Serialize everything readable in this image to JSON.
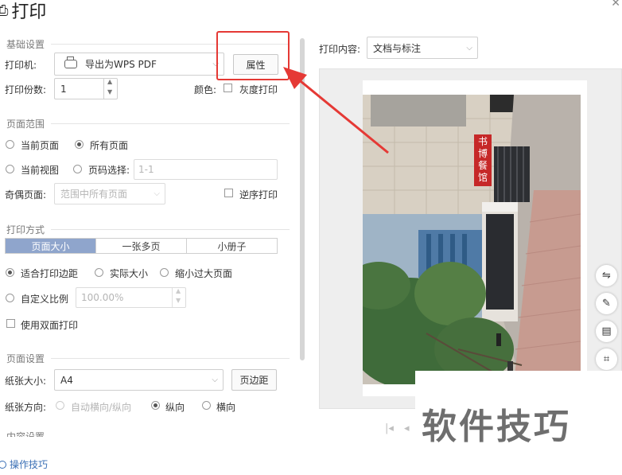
{
  "window": {
    "title": "打印"
  },
  "basic": {
    "section_title": "基础设置",
    "printer_label": "打印机:",
    "printer_value": "导出为WPS PDF",
    "properties_button": "属性",
    "copies_label": "打印份数:",
    "copies_value": "1",
    "color_label": "颜色:",
    "grayscale_label": "灰度打印"
  },
  "page_range": {
    "section_title": "页面范围",
    "current_page": "当前页面",
    "all_pages": "所有页面",
    "current_view": "当前视图",
    "page_select": "页码选择:",
    "page_select_placeholder": "1-1",
    "odd_even_label": "奇偶页面:",
    "odd_even_value": "范围中所有页面",
    "reverse_print": "逆序打印"
  },
  "print_mode": {
    "section_title": "打印方式",
    "tabs": [
      "页面大小",
      "一张多页",
      "小册子"
    ],
    "fit_margins": "适合打印边距",
    "actual_size": "实际大小",
    "shrink_large": "缩小过大页面",
    "custom_scale": "自定义比例",
    "scale_value": "100.00%",
    "duplex": "使用双面打印"
  },
  "page_setup": {
    "section_title": "页面设置",
    "paper_size_label": "纸张大小:",
    "paper_size_value": "A4",
    "margins_button": "页边距",
    "orientation_label": "纸张方向:",
    "auto_orientation": "自动横向/纵向",
    "portrait": "纵向",
    "landscape": "横向"
  },
  "content_setup": {
    "section_title": "内容设置"
  },
  "footer": {
    "tips_link": "操作技巧"
  },
  "preview": {
    "content_label": "打印内容:",
    "content_value": "文档与标注",
    "sign_text": "书 博 餐 馆"
  },
  "watermark": "软件技巧",
  "colors": {
    "annotation": "#e53935",
    "accent": "#8fa5cc"
  }
}
